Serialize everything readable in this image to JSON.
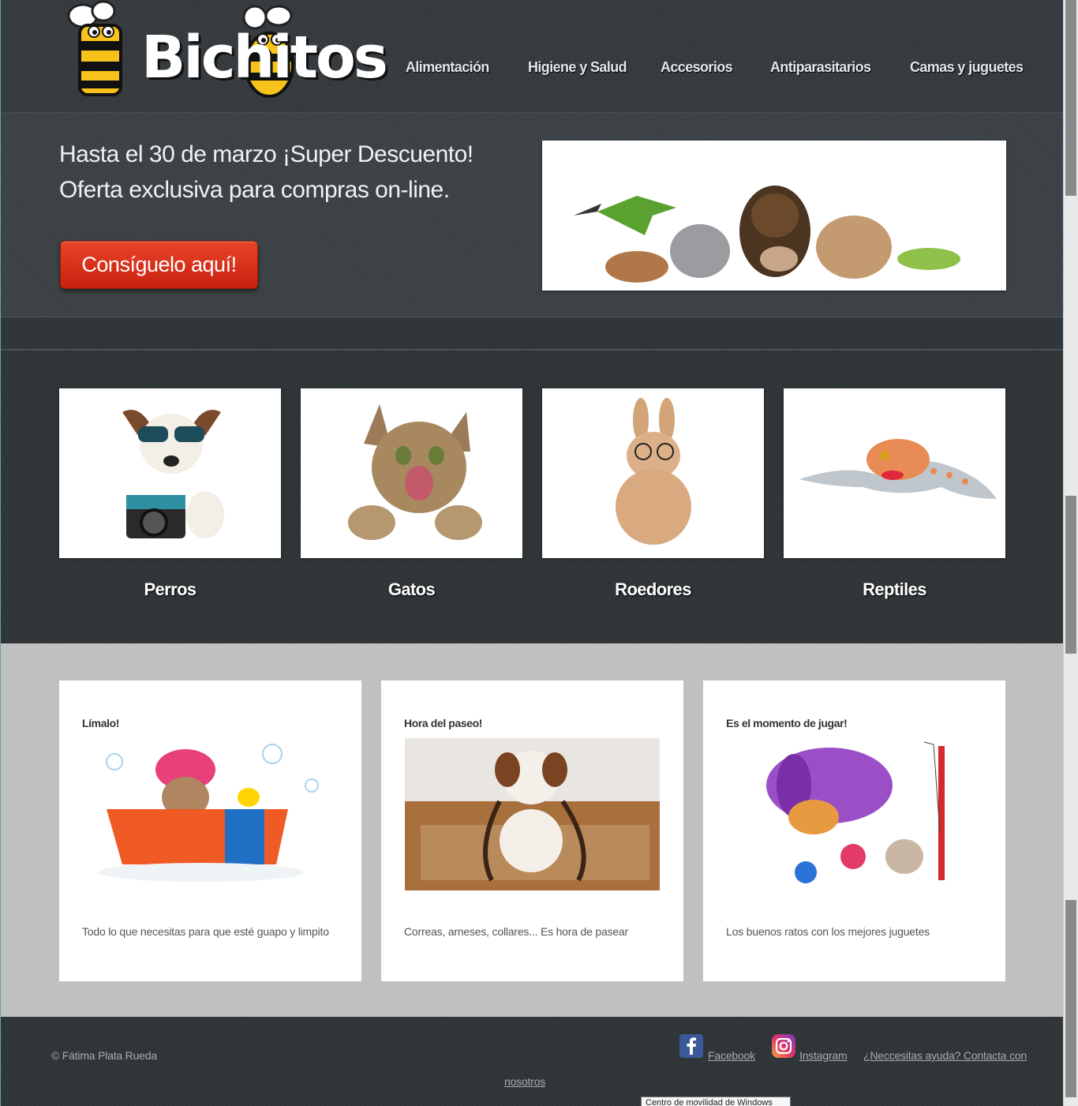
{
  "brand": {
    "logo_text": "Bichitos"
  },
  "nav": {
    "items": [
      "Alimentación",
      "Higiene y Salud",
      "Accesorios",
      "Antiparasitarios",
      "Camas y juguetes"
    ]
  },
  "hero": {
    "line1": "Hasta el 30 de marzo ¡Super Descuento!",
    "line2": "Oferta exclusiva para compras on-line.",
    "cta_label": "Consíguelo aquí!"
  },
  "categories": [
    "Perros",
    "Gatos",
    "Roedores",
    "Reptiles"
  ],
  "features": [
    {
      "title": "Límalo!",
      "text": "Todo lo que necesitas para que esté guapo y limpito"
    },
    {
      "title": "Hora del paseo!",
      "text": "Correas, arneses, collares... Es hora de pasear"
    },
    {
      "title": "Es el momento de jugar!",
      "text": "Los buenos ratos con los mejores juguetes"
    }
  ],
  "footer": {
    "copyright": "© Fátima Plata Rueda",
    "facebook": "Facebook",
    "instagram": "Instagram",
    "help_line1": "¿Neccesitas ayuda? Contacta con",
    "help_line2": "nosotros"
  },
  "tooltip": "Centro de movilidad de Windows",
  "icons": {
    "facebook": "facebook-icon",
    "instagram": "instagram-icon"
  },
  "colors": {
    "cta": "#d9301a",
    "header_bg": "#343a3e",
    "features_bg": "#c0c0c0"
  }
}
